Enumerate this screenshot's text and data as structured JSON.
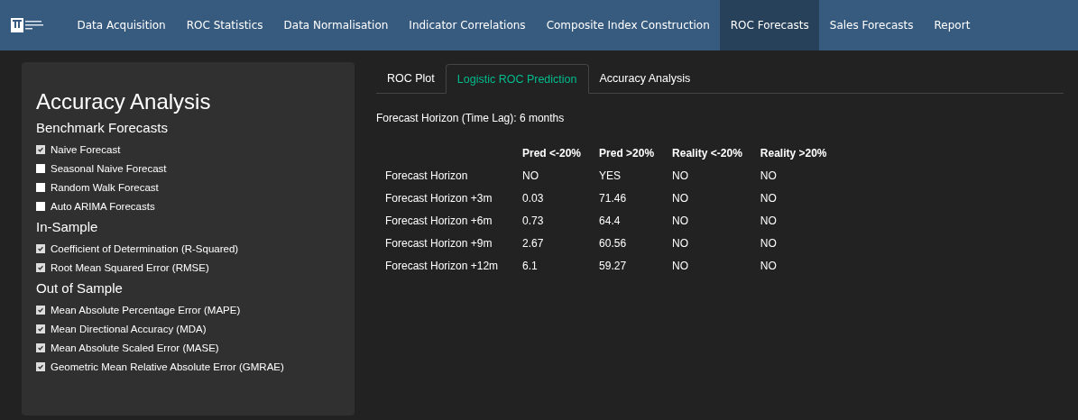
{
  "nav": [
    {
      "label": "Data Acquisition",
      "selected": false
    },
    {
      "label": "ROC Statistics",
      "selected": false
    },
    {
      "label": "Data Normalisation",
      "selected": false
    },
    {
      "label": "Indicator Correlations",
      "selected": false
    },
    {
      "label": "Composite Index Construction",
      "selected": false
    },
    {
      "label": "ROC Forecasts",
      "selected": true
    },
    {
      "label": "Sales Forecasts",
      "selected": false
    },
    {
      "label": "Report",
      "selected": false
    }
  ],
  "sidebar": {
    "title": "Accuracy Analysis",
    "groups": [
      {
        "heading": "Benchmark Forecasts",
        "items": [
          {
            "label": "Naive Forecast",
            "checked": true
          },
          {
            "label": "Seasonal Naive Forecast",
            "checked": false
          },
          {
            "label": "Random Walk Forecast",
            "checked": false
          },
          {
            "label": "Auto ARIMA Forecasts",
            "checked": false
          }
        ]
      },
      {
        "heading": "In-Sample",
        "items": [
          {
            "label": "Coefficient of Determination (R-Squared)",
            "checked": true
          },
          {
            "label": "Root Mean Squared Error (RMSE)",
            "checked": true
          }
        ]
      },
      {
        "heading": "Out of Sample",
        "items": [
          {
            "label": "Mean Absolute Percentage Error (MAPE)",
            "checked": true
          },
          {
            "label": "Mean Directional Accuracy (MDA)",
            "checked": true
          },
          {
            "label": "Mean Absolute Scaled Error (MASE)",
            "checked": true
          },
          {
            "label": "Geometric Mean Relative Absolute Error (GMRAE)",
            "checked": true
          }
        ]
      }
    ]
  },
  "tabs": [
    {
      "label": "ROC Plot",
      "selected": false
    },
    {
      "label": "Logistic ROC Prediction",
      "selected": true
    },
    {
      "label": "Accuracy Analysis",
      "selected": false
    }
  ],
  "horizon_text": "Forecast Horizon (Time Lag): 6 months",
  "table": {
    "columns": [
      "",
      "Pred <-20%",
      "Pred >20%",
      "Reality <-20%",
      "Reality >20%"
    ],
    "rows": [
      [
        "Forecast Horizon",
        "NO",
        "YES",
        "NO",
        "NO"
      ],
      [
        "Forecast Horizon +3m",
        "0.03",
        "71.46",
        "NO",
        "NO"
      ],
      [
        "Forecast Horizon +6m",
        "0.73",
        "64.4",
        "NO",
        "NO"
      ],
      [
        "Forecast Horizon +9m",
        "2.67",
        "60.56",
        "NO",
        "NO"
      ],
      [
        "Forecast Horizon +12m",
        "6.1",
        "59.27",
        "NO",
        "NO"
      ]
    ]
  }
}
